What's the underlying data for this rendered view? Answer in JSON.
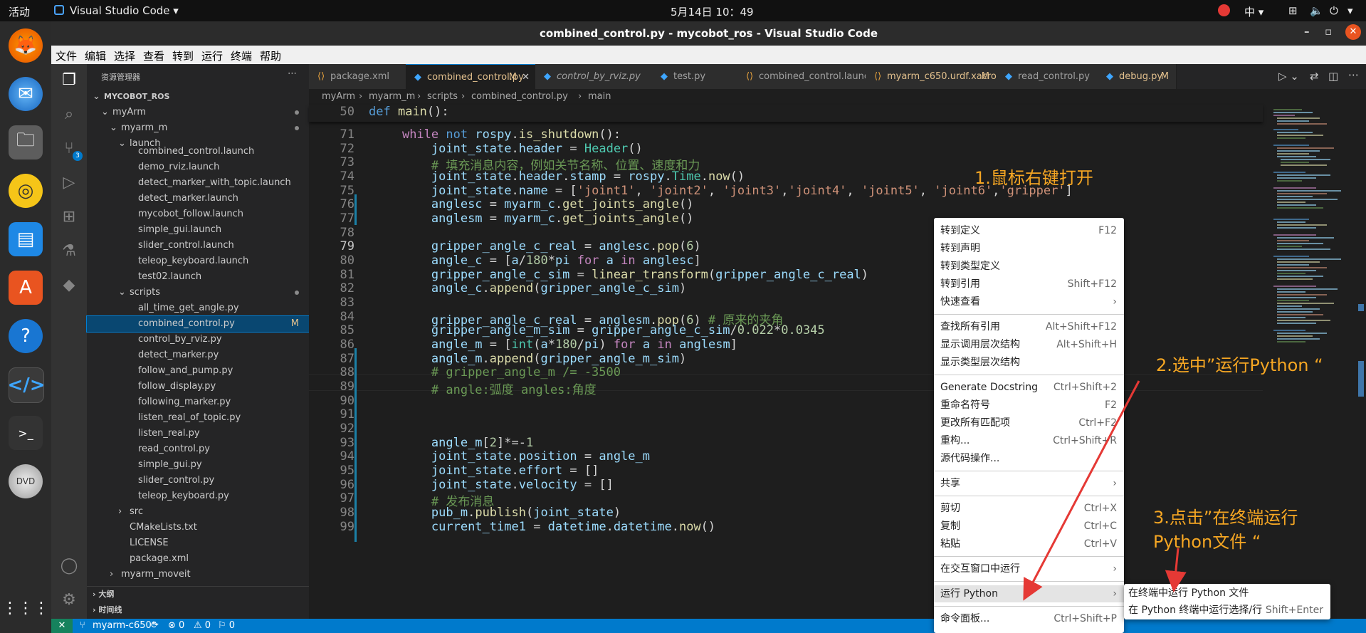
{
  "topbar": {
    "activities": "活动",
    "app": "Visual Studio Code ▾",
    "clock": "5月14日  10：49",
    "ime": "中 ▾"
  },
  "window": {
    "title": "combined_control.py - mycobot_ros - Visual Studio Code"
  },
  "menubar": [
    "文件",
    "编辑",
    "选择",
    "查看",
    "转到",
    "运行",
    "终端",
    "帮助"
  ],
  "sidebar": {
    "header": "资源管理器",
    "rows": [
      {
        "indent": 0,
        "label": "MYCOBOT_ROS",
        "arrow": "⌄",
        "bold": true
      },
      {
        "indent": 1,
        "label": "myArm",
        "arrow": "⌄",
        "dot": true
      },
      {
        "indent": 2,
        "label": "myarm_m",
        "arrow": "⌄",
        "dot": true
      },
      {
        "indent": 3,
        "label": "launch",
        "arrow": "⌄"
      },
      {
        "indent": 4,
        "label": "combined_control.launch"
      },
      {
        "indent": 4,
        "label": "demo_rviz.launch"
      },
      {
        "indent": 4,
        "label": "detect_marker_with_topic.launch"
      },
      {
        "indent": 4,
        "label": "detect_marker.launch"
      },
      {
        "indent": 4,
        "label": "mycobot_follow.launch"
      },
      {
        "indent": 4,
        "label": "simple_gui.launch"
      },
      {
        "indent": 4,
        "label": "slider_control.launch"
      },
      {
        "indent": 4,
        "label": "teleop_keyboard.launch"
      },
      {
        "indent": 4,
        "label": "test02.launch"
      },
      {
        "indent": 3,
        "label": "scripts",
        "arrow": "⌄",
        "dot": true
      },
      {
        "indent": 4,
        "label": "all_time_get_angle.py"
      },
      {
        "indent": 4,
        "label": "combined_control.py",
        "badge": "M",
        "selected": true
      },
      {
        "indent": 4,
        "label": "control_by_rviz.py"
      },
      {
        "indent": 4,
        "label": "detect_marker.py"
      },
      {
        "indent": 4,
        "label": "follow_and_pump.py"
      },
      {
        "indent": 4,
        "label": "follow_display.py"
      },
      {
        "indent": 4,
        "label": "following_marker.py"
      },
      {
        "indent": 4,
        "label": "listen_real_of_topic.py"
      },
      {
        "indent": 4,
        "label": "listen_real.py"
      },
      {
        "indent": 4,
        "label": "read_control.py"
      },
      {
        "indent": 4,
        "label": "simple_gui.py"
      },
      {
        "indent": 4,
        "label": "slider_control.py"
      },
      {
        "indent": 4,
        "label": "teleop_keyboard.py"
      },
      {
        "indent": 3,
        "label": "src",
        "arrow": "›"
      },
      {
        "indent": 3,
        "label": "CMakeLists.txt"
      },
      {
        "indent": 3,
        "label": "LICENSE"
      },
      {
        "indent": 3,
        "label": "package.xml"
      },
      {
        "indent": 2,
        "label": "myarm_moveit",
        "arrow": "›"
      }
    ],
    "outline": "大纲",
    "timeline": "时间线"
  },
  "tabs": [
    {
      "label": "package.xml"
    },
    {
      "label": "combined_control.py",
      "badge": "M",
      "active": true
    },
    {
      "label": "control_by_rviz.py",
      "italic": true
    },
    {
      "label": "test.py"
    },
    {
      "label": "combined_control.launch"
    },
    {
      "label": "myarm_c650.urdf.xacro",
      "badge": "M"
    },
    {
      "label": "read_control.py"
    },
    {
      "label": "debug.py",
      "badge": "M"
    }
  ],
  "breadcrumb": [
    "myArm",
    "myarm_m",
    "scripts",
    "combined_control.py",
    "main"
  ],
  "code": {
    "sticky": {
      "num": "50",
      "html": "<span class=\"blue\">def</span> <span class=\"fn\">main</span>():"
    },
    "lines": [
      {
        "num": "71",
        "html": "    <span class=\"kw\">while</span> <span class=\"blue\">not</span> <span class=\"var\">rospy</span>.<span class=\"fn\">is_shutdown</span>():"
      },
      {
        "num": "72",
        "html": "        <span class=\"var\">joint_state</span>.<span class=\"var\">header</span> = <span class=\"cls\">Header</span>()"
      },
      {
        "num": "73",
        "html": "        <span class=\"cm\"># 填充消息内容，例如关节名称、位置、速度和力</span>"
      },
      {
        "num": "74",
        "html": "        <span class=\"var\">joint_state</span>.<span class=\"var\">header</span>.<span class=\"var\">stamp</span> = <span class=\"var\">rospy</span>.<span class=\"cls\">Time</span>.<span class=\"fn\">now</span>()"
      },
      {
        "num": "75",
        "html": "        <span class=\"var\">joint_state</span>.<span class=\"var\">name</span> = [<span class=\"str\">'joint1'</span>, <span class=\"str\">'joint2'</span>, <span class=\"str\">'joint3'</span>,<span class=\"str\">'joint4'</span>, <span class=\"str\">'joint5'</span>, <span class=\"str\">'joint6'</span>,<span class=\"str\">'gripper'</span>]"
      },
      {
        "num": "76",
        "html": "        <span class=\"var\">anglesc</span> = <span class=\"var\">myarm_c</span>.<span class=\"fn\">get_joints_angle</span>()"
      },
      {
        "num": "77",
        "html": "        <span class=\"var\">anglesm</span> = <span class=\"var\">myarm_c</span>.<span class=\"fn\">get_joints_angle</span>()"
      },
      {
        "num": "78",
        "html": ""
      },
      {
        "num": "79",
        "html": "        <span class=\"var\">gripper_angle_c_real</span> = <span class=\"var\">anglesc</span>.<span class=\"fn\">pop</span>(<span class=\"num\">6</span>)"
      },
      {
        "num": "80",
        "html": "        <span class=\"var\">angle_c</span> = [<span class=\"var\">a</span>/<span class=\"num\">180</span>*<span class=\"var\">pi</span> <span class=\"kw\">for</span> <span class=\"var\">a</span> <span class=\"kw\">in</span> <span class=\"var\">anglesc</span>]"
      },
      {
        "num": "81",
        "html": "        <span class=\"var\">gripper_angle_c_sim</span> = <span class=\"fn\">linear_transform</span>(<span class=\"var\">gripper_angle_c_real</span>)"
      },
      {
        "num": "82",
        "html": "        <span class=\"var\">angle_c</span>.<span class=\"fn\">append</span>(<span class=\"var\">gripper_angle_c_sim</span>)"
      },
      {
        "num": "83",
        "html": ""
      },
      {
        "num": "84",
        "html": "        <span class=\"var\">gripper_angle_c_real</span> = <span class=\"var\">anglesm</span>.<span class=\"fn\">pop</span>(<span class=\"num\">6</span>) <span class=\"cm\"># 原来的夹角</span>"
      },
      {
        "num": "85",
        "html": "        <span class=\"var\">gripper_angle_m_sim</span> = <span class=\"var\">gripper_angle_c_sim</span>/<span class=\"num\">0.022</span>*<span class=\"num\">0.0345</span>"
      },
      {
        "num": "86",
        "html": "        <span class=\"var\">angle_m</span> = [<span class=\"cls\">int</span>(<span class=\"var\">a</span>*<span class=\"num\">180</span>/<span class=\"var\">pi</span>) <span class=\"kw\">for</span> <span class=\"var\">a</span> <span class=\"kw\">in</span> <span class=\"var\">anglesm</span>]"
      },
      {
        "num": "87",
        "html": "        <span class=\"var\">angle_m</span>.<span class=\"fn\">append</span>(<span class=\"var\">gripper_angle_m_sim</span>)"
      },
      {
        "num": "88",
        "html": "        <span class=\"cm\"># gripper_angle_m /= -3500</span>"
      },
      {
        "num": "89",
        "html": "        <span class=\"cm\"># angle:弧度 angles:角度</span>"
      },
      {
        "num": "90",
        "html": ""
      },
      {
        "num": "91",
        "html": ""
      },
      {
        "num": "92",
        "html": ""
      },
      {
        "num": "93",
        "html": "        <span class=\"var\">angle_m</span>[<span class=\"num\">2</span>]*=-<span class=\"num\">1</span>"
      },
      {
        "num": "94",
        "html": "        <span class=\"var\">joint_state</span>.<span class=\"var\">position</span> = <span class=\"var\">angle_m</span>"
      },
      {
        "num": "95",
        "html": "        <span class=\"var\">joint_state</span>.<span class=\"var\">effort</span> = []"
      },
      {
        "num": "96",
        "html": "        <span class=\"var\">joint_state</span>.<span class=\"var\">velocity</span> = []"
      },
      {
        "num": "97",
        "html": "        <span class=\"cm\"># 发布消息</span>"
      },
      {
        "num": "98",
        "html": "        <span class=\"var\">pub_m</span>.<span class=\"fn\">publish</span>(<span class=\"var\">joint_state</span>)"
      },
      {
        "num": "99",
        "html": "        <span class=\"var\">current_time1</span> = <span class=\"var\">datetime</span>.<span class=\"var\">datetime</span>.<span class=\"fn\">now</span>()"
      }
    ]
  },
  "context_menu": {
    "items": [
      {
        "label": "转到定义",
        "kb": "F12"
      },
      {
        "label": "转到声明",
        "kb": ""
      },
      {
        "label": "转到类型定义",
        "kb": ""
      },
      {
        "label": "转到引用",
        "kb": "Shift+F12"
      },
      {
        "label": "快速查看",
        "kb": "›"
      },
      {
        "sep": true
      },
      {
        "label": "查找所有引用",
        "kb": "Alt+Shift+F12"
      },
      {
        "label": "显示调用层次结构",
        "kb": "Alt+Shift+H"
      },
      {
        "label": "显示类型层次结构",
        "kb": ""
      },
      {
        "sep": true
      },
      {
        "label": "Generate Docstring",
        "kb": "Ctrl+Shift+2"
      },
      {
        "label": "重命名符号",
        "kb": "F2"
      },
      {
        "label": "更改所有匹配项",
        "kb": "Ctrl+F2"
      },
      {
        "label": "重构...",
        "kb": "Ctrl+Shift+R"
      },
      {
        "label": "源代码操作...",
        "kb": ""
      },
      {
        "sep": true
      },
      {
        "label": "共享",
        "kb": "›"
      },
      {
        "sep": true
      },
      {
        "label": "剪切",
        "kb": "Ctrl+X"
      },
      {
        "label": "复制",
        "kb": "Ctrl+C"
      },
      {
        "label": "粘贴",
        "kb": "Ctrl+V"
      },
      {
        "sep": true
      },
      {
        "label": "在交互窗口中运行",
        "kb": "›"
      },
      {
        "sep": true
      },
      {
        "label": "运行 Python",
        "kb": "›",
        "highlight": true
      },
      {
        "sep": true
      },
      {
        "label": "命令面板...",
        "kb": "Ctrl+Shift+P"
      }
    ],
    "submenu": [
      {
        "label": "在终端中运行 Python 文件",
        "kb": ""
      },
      {
        "label": "在 Python 终端中运行选择/行",
        "kb": "Shift+Enter"
      }
    ]
  },
  "annotations": {
    "step1": "1.鼠标右键打开",
    "step2": "2.选中”运行Python “",
    "step3a": "3.点击”在终端运行",
    "step3b": "Python文件 “"
  },
  "statusbar": {
    "branch": "myarm-c650*",
    "sync": "⟳",
    "errors": "⊗ 0",
    "warnings": "⚠ 0",
    "info": "⚐ 0"
  },
  "colors": {
    "accent": "#007acc",
    "annotation": "#f5a623",
    "arrow": "#e53935"
  }
}
